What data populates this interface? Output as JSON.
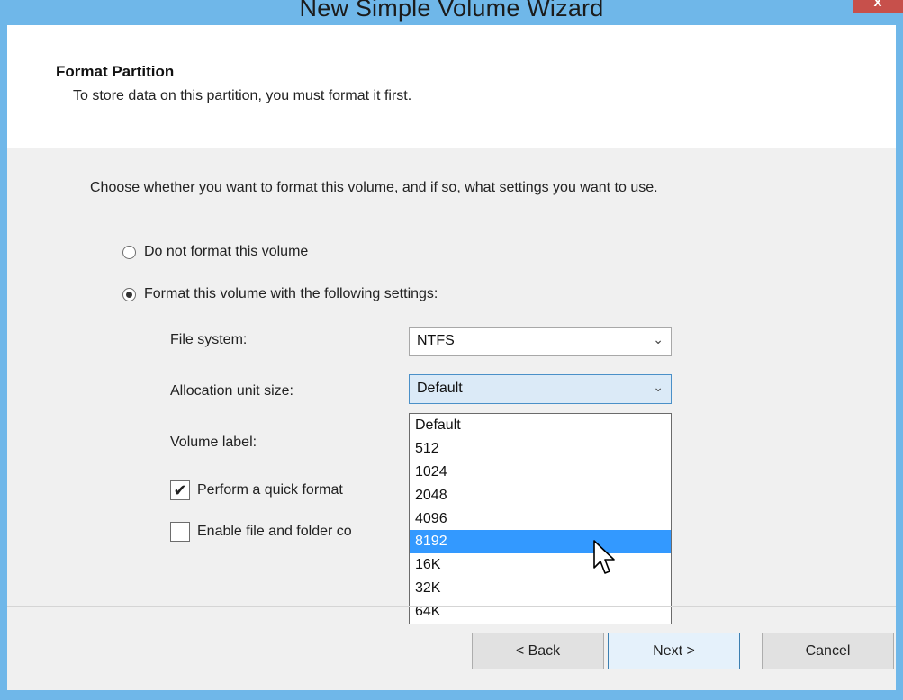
{
  "window": {
    "title": "New Simple Volume Wizard",
    "close_label": "x"
  },
  "header": {
    "title": "Format Partition",
    "subtitle": "To store data on this partition, you must format it first."
  },
  "instructions": "Choose whether you want to format this volume, and if so, what settings you want to use.",
  "options": {
    "no_format": {
      "label": "Do not format this volume",
      "selected": false
    },
    "format": {
      "label": "Format this volume with the following settings:",
      "selected": true
    }
  },
  "fields": {
    "file_system": {
      "label": "File system:",
      "value": "NTFS"
    },
    "allocation_unit": {
      "label": "Allocation unit size:",
      "value": "Default"
    },
    "volume_label": {
      "label": "Volume label:"
    }
  },
  "checkboxes": {
    "quick_format": {
      "label": "Perform a quick format",
      "checked": true
    },
    "compression": {
      "label": "Enable file and folder co",
      "checked": false
    }
  },
  "allocation_dropdown": {
    "items": [
      "Default",
      "512",
      "1024",
      "2048",
      "4096",
      "8192",
      "16K",
      "32K",
      "64K"
    ],
    "highlighted": "8192"
  },
  "buttons": {
    "back": "< Back",
    "next": "Next >",
    "cancel": "Cancel"
  },
  "colors": {
    "title_bar": "#6fb7e9",
    "highlight": "#3399ff",
    "close_button": "#c7504b"
  }
}
